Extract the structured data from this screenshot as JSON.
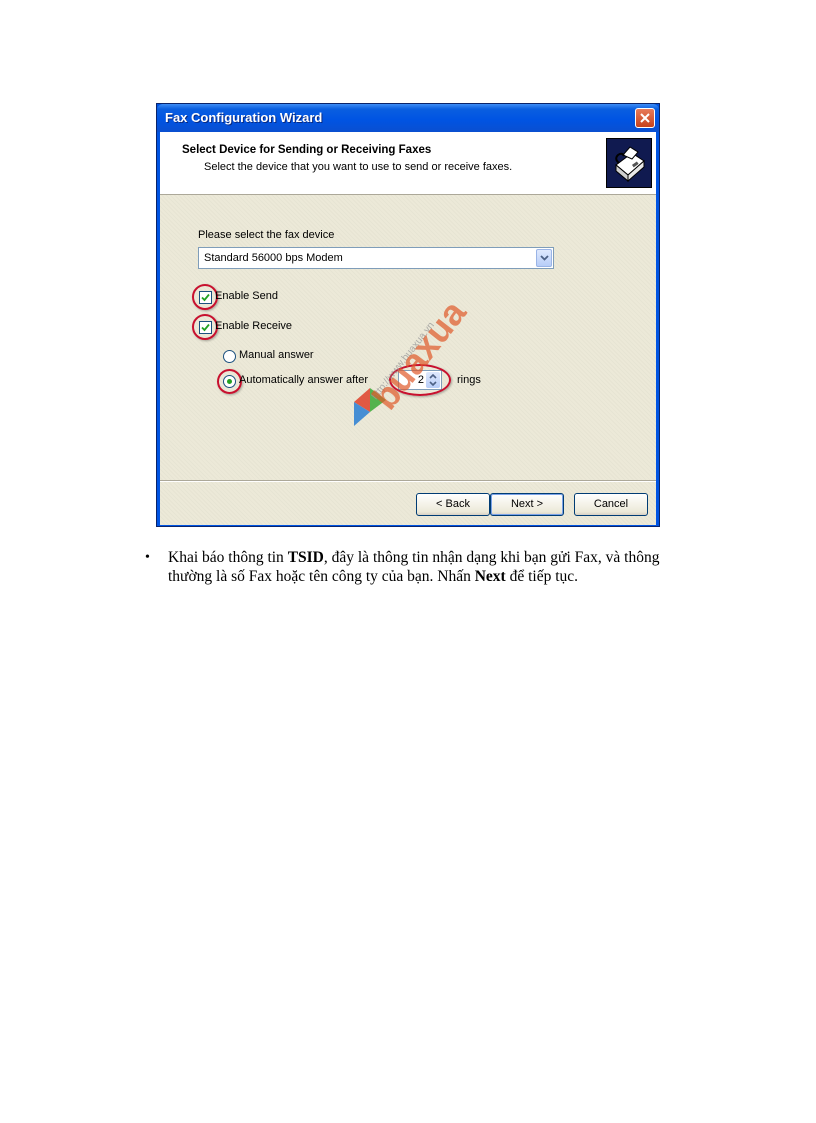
{
  "window": {
    "title": "Fax Configuration Wizard"
  },
  "header": {
    "title": "Select Device for Sending or Receiving Faxes",
    "subtitle": "Select the device that you want to use to send or receive faxes."
  },
  "device": {
    "label": "Please select the fax device",
    "selected": "Standard 56000 bps Modem"
  },
  "options": {
    "enable_send": "Enable Send",
    "enable_receive": "Enable Receive",
    "manual_answer": "Manual answer",
    "auto_answer": "Automatically answer after",
    "rings_value": "2",
    "rings_label": "rings"
  },
  "buttons": {
    "back": "< Back",
    "next": "Next >",
    "cancel": "Cancel"
  },
  "watermark": {
    "url": "http://www.buaxua.vn",
    "brand": "buaxua"
  },
  "caption": {
    "part1": "Khai báo thông tin ",
    "bold1": "TSID",
    "part2": ", đây là thông tin nhận dạng khi bạn gửi Fax, và thông thường là số Fax hoặc tên công ty của bạn. Nhấn ",
    "bold2": "Next",
    "part3": " để tiếp tục."
  },
  "colors": {
    "titlebar": "#0054e3",
    "dialog_bg": "#ece9d8",
    "highlight_ring": "#c8102e",
    "checkmark": "#21a121"
  }
}
